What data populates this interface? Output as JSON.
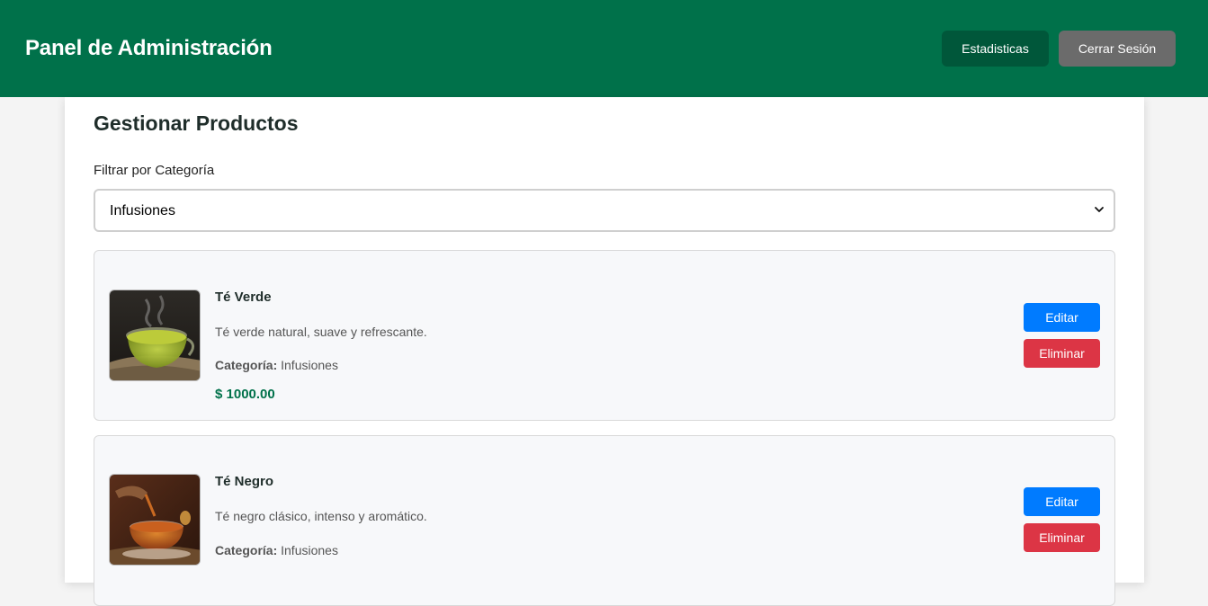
{
  "header": {
    "title": "Panel de Administración",
    "stats_label": "Estadisticas",
    "logout_label": "Cerrar Sesión"
  },
  "main": {
    "title": "Gestionar Productos",
    "filter_label": "Filtrar por Categoría",
    "filter_selected": "Infusiones"
  },
  "products": [
    {
      "name": "Té Verde",
      "description": "Té verde natural, suave y refrescante.",
      "category_label": "Categoría:",
      "category": "Infusiones",
      "price": "$ 1000.00",
      "edit_label": "Editar",
      "delete_label": "Eliminar"
    },
    {
      "name": "Té Negro",
      "description": "Té negro clásico, intenso y aromático.",
      "category_label": "Categoría:",
      "category": "Infusiones",
      "edit_label": "Editar",
      "delete_label": "Eliminar"
    }
  ],
  "colors": {
    "header": "#00714a",
    "stats_button": "#00573a",
    "logout_button": "#6b6b6b",
    "edit_button": "#007bff",
    "delete_button": "#dc3545",
    "price": "#00714a"
  }
}
